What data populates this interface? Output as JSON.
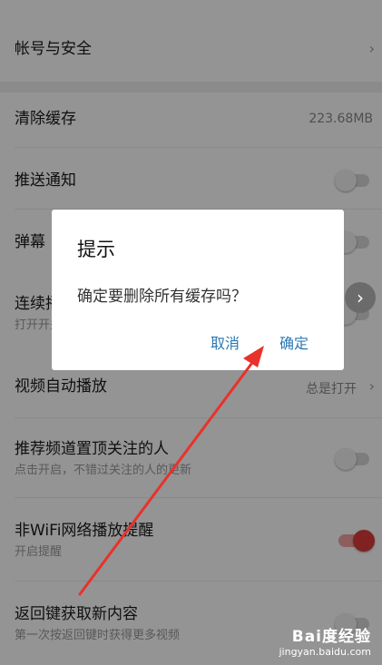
{
  "settings": {
    "account_security": "帐号与安全",
    "clear_cache": {
      "label": "清除缓存",
      "value": "223.68MB"
    },
    "push_notify": {
      "label": "推送通知"
    },
    "danmaku": {
      "label": "弹幕"
    },
    "continuous": {
      "label": "连续播放",
      "sub": "打开开关"
    },
    "video_autoplay": {
      "label": "视频自动播放",
      "value": "总是打开"
    },
    "recommend_top": {
      "label": "推荐频道置顶关注的人",
      "sub": "点击开启，不错过关注的人的更新"
    },
    "non_wifi": {
      "label": "非WiFi网络播放提醒",
      "sub": "开启提醒"
    },
    "back_refresh": {
      "label": "返回键获取新内容",
      "sub": "第一次按返回键时获得更多视频"
    }
  },
  "dialog": {
    "title": "提示",
    "message": "确定要删除所有缓存吗？",
    "cancel": "取消",
    "confirm": "确定"
  },
  "watermark": {
    "brand": "Bai度经验",
    "url": "jingyan.baidu.com"
  },
  "colors": {
    "accent_red": "#dc3b3b",
    "dialog_button": "#2a78b4"
  }
}
